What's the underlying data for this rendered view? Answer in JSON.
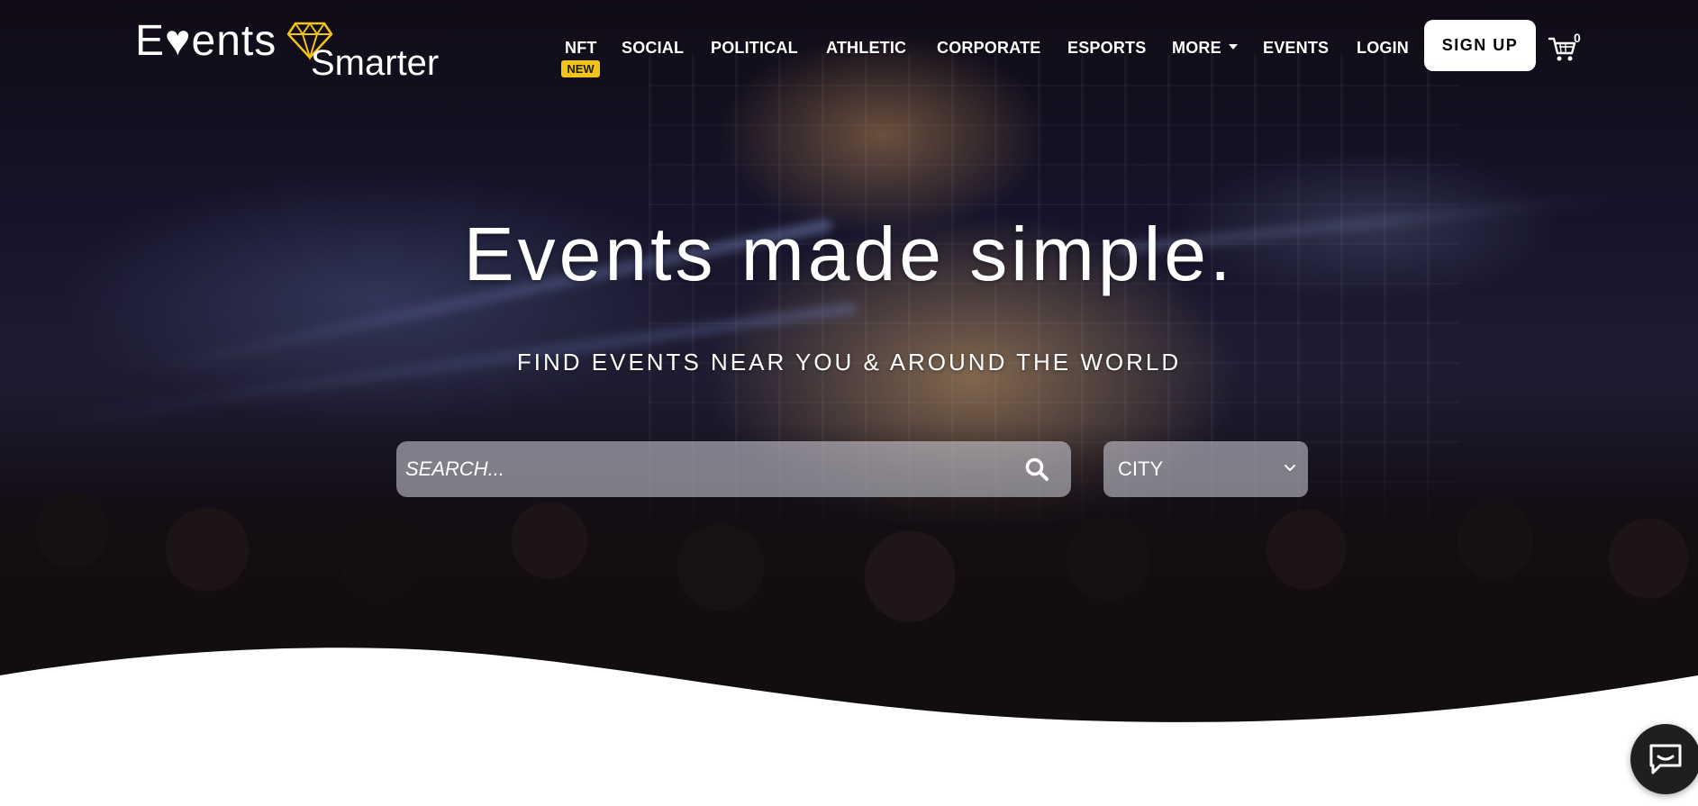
{
  "brand": {
    "name_part1": "E♥ents",
    "name_part2": "Smarter"
  },
  "nav": {
    "items": [
      {
        "label": "NFT",
        "badge": "NEW"
      },
      {
        "label": "SOCIAL"
      },
      {
        "label": "POLITICAL"
      },
      {
        "label": "ATHLETIC"
      },
      {
        "label": "CORPORATE"
      },
      {
        "label": "ESPORTS"
      },
      {
        "label": "MORE",
        "has_dropdown": true
      },
      {
        "label": "EVENTS"
      },
      {
        "label": "LOGIN"
      }
    ],
    "signup_label": "SIGN UP",
    "cart_count": "0"
  },
  "hero": {
    "headline": "Events made simple.",
    "subheadline": "FIND EVENTS NEAR YOU & AROUND THE WORLD"
  },
  "search": {
    "placeholder": "SEARCH...",
    "value": "",
    "city_selected": "CITY"
  },
  "colors": {
    "accent_badge": "#f2c418",
    "primary_text": "#ffffff",
    "button_bg": "#ffffff",
    "chat_bg": "#1f1f1f"
  },
  "icons": {
    "logo_gem": "diamond-icon",
    "cart": "cart-icon",
    "search": "search-icon",
    "city_dropdown": "chevron-down-icon",
    "chat": "chat-bubble-icon"
  }
}
